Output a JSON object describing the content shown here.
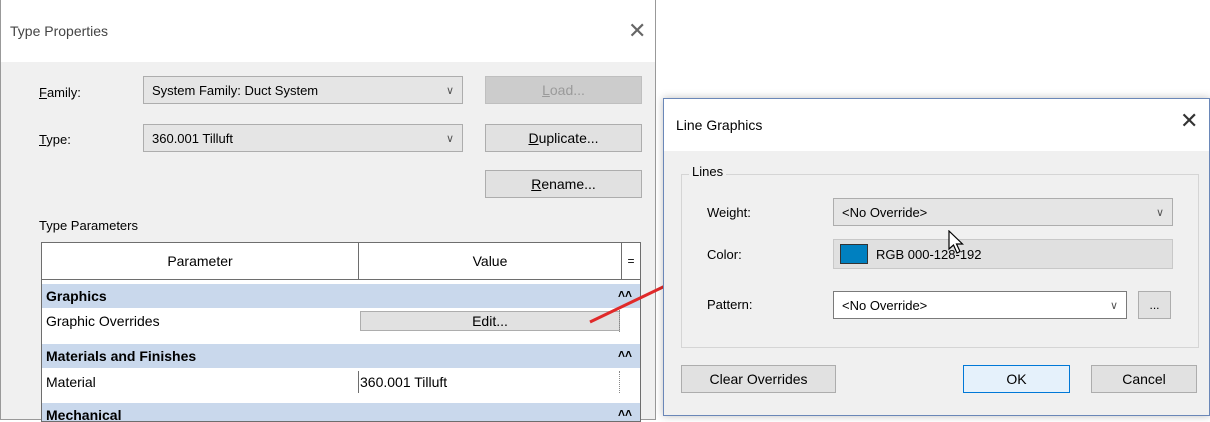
{
  "type_properties": {
    "title": "Type Properties",
    "family_label": "Family:",
    "family_underline": "F",
    "family_rest": "amily:",
    "family_value": "System Family: Duct System",
    "type_underline": "T",
    "type_rest": "ype:",
    "type_value": "360.001 Tilluft",
    "load_underline": "L",
    "load_rest": "oad...",
    "duplicate_underline": "D",
    "duplicate_rest": "uplicate...",
    "rename_underline": "R",
    "rename_rest": "ename...",
    "section_title": "Type Parameters",
    "table": {
      "col_parameter": "Parameter",
      "col_value": "Value",
      "col_extra": "=",
      "groups": [
        {
          "label": "Graphics",
          "collapse": "˄˄"
        },
        {
          "label": "Materials and Finishes",
          "collapse": "˄˄"
        },
        {
          "label": "Mechanical",
          "collapse": "˄˄"
        }
      ],
      "rows": [
        {
          "name": "Graphic Overrides",
          "value": "Edit..."
        },
        {
          "name": "Material",
          "value": "360.001 Tilluft"
        }
      ]
    }
  },
  "line_graphics": {
    "title": "Line Graphics",
    "group_title": "Lines",
    "weight_label": "Weight:",
    "weight_value": "<No Override>",
    "color_label": "Color:",
    "color_value": "RGB 000-128-192",
    "color_hex": "#0080c0",
    "pattern_label": "Pattern:",
    "pattern_value": "<No Override>",
    "pattern_more": "...",
    "clear_overrides": "Clear Overrides",
    "ok": "OK",
    "cancel": "Cancel"
  },
  "icons": {
    "close": "✕",
    "chevron": "∨"
  }
}
